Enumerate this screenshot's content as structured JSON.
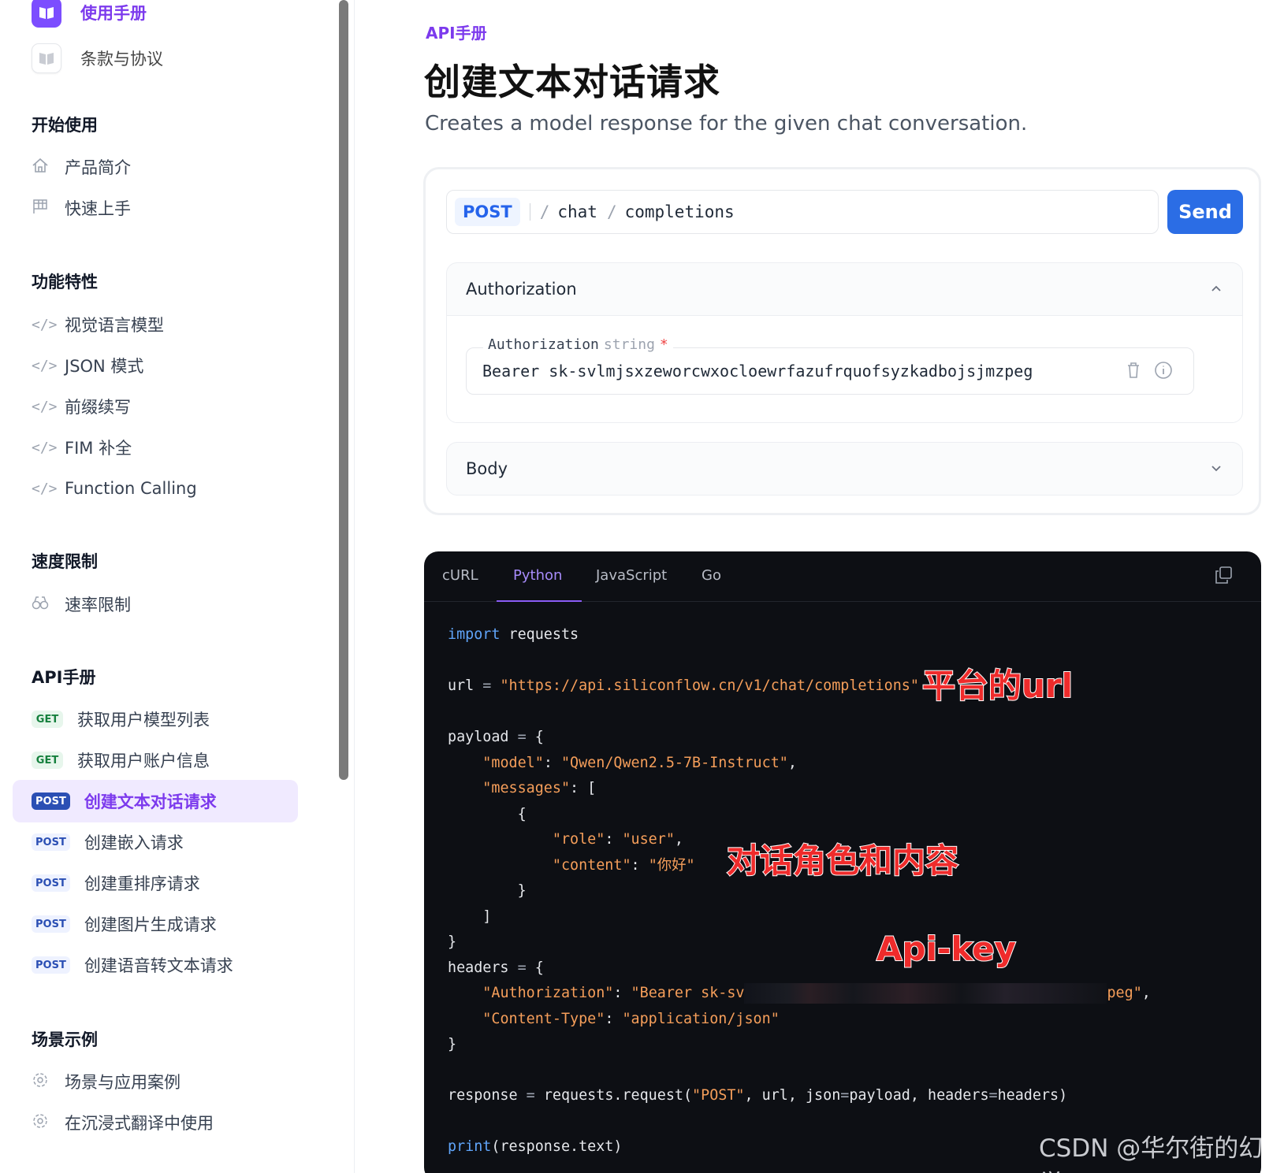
{
  "sidebar": {
    "top_links": [
      {
        "label": "使用手册",
        "active": true
      },
      {
        "label": "条款与协议",
        "active": false
      }
    ],
    "sections": [
      {
        "title": "开始使用",
        "items": [
          {
            "icon": "home-icon",
            "label": "产品简介"
          },
          {
            "icon": "flag-icon",
            "label": "快速上手"
          }
        ]
      },
      {
        "title": "功能特性",
        "items": [
          {
            "icon": "code-icon",
            "label": "视觉语言模型"
          },
          {
            "icon": "code-icon",
            "label": "JSON 模式"
          },
          {
            "icon": "code-icon",
            "label": "前缀续写"
          },
          {
            "icon": "code-icon",
            "label": "FIM 补全"
          },
          {
            "icon": "code-icon",
            "label": "Function Calling"
          }
        ]
      },
      {
        "title": "速度限制",
        "items": [
          {
            "icon": "binoculars-icon",
            "label": "速率限制"
          }
        ]
      },
      {
        "title": "API手册",
        "api_items": [
          {
            "method": "GET",
            "label": "获取用户模型列表",
            "active": false
          },
          {
            "method": "GET",
            "label": "获取用户账户信息",
            "active": false
          },
          {
            "method": "POST",
            "label": "创建文本对话请求",
            "active": true
          },
          {
            "method": "POST",
            "label": "创建嵌入请求",
            "active": false
          },
          {
            "method": "POST",
            "label": "创建重排序请求",
            "active": false
          },
          {
            "method": "POST",
            "label": "创建图片生成请求",
            "active": false
          },
          {
            "method": "POST",
            "label": "创建语音转文本请求",
            "active": false
          }
        ]
      },
      {
        "title": "场景示例",
        "items": [
          {
            "icon": "gear-icon",
            "label": "场景与应用案例"
          },
          {
            "icon": "gear-icon",
            "label": "在沉浸式翻译中使用"
          }
        ]
      }
    ]
  },
  "main": {
    "breadcrumb": "API手册",
    "title": "创建文本对话请求",
    "subtitle": "Creates a model response for the given chat conversation.",
    "request": {
      "method": "POST",
      "path": [
        "chat",
        "completions"
      ],
      "send_label": "Send",
      "auth_panel_title": "Authorization",
      "auth_field_label": "Authorization",
      "auth_field_type": "string",
      "auth_field_required": "*",
      "auth_value": "Bearer sk-svlmjsxzeworcwxocloewrfazufrquofsyzkadbojsjmzpeg",
      "body_panel_title": "Body"
    },
    "code": {
      "tabs": [
        "cURL",
        "Python",
        "JavaScript",
        "Go"
      ],
      "active_tab": "Python",
      "lines": {
        "import_kw": "import",
        "import_mod": " requests",
        "url_var": "url",
        "url_value": "\"https://api.siliconflow.cn/v1/chat/completions\"",
        "payload_var": "payload",
        "model_key": "\"model\"",
        "model_value": "\"Qwen/Qwen2.5-7B-Instruct\"",
        "messages_key": "\"messages\"",
        "role_key": "\"role\"",
        "role_value": "\"user\"",
        "content_key": "\"content\"",
        "content_value": "\"你好\"",
        "headers_var": "headers",
        "auth_key": "\"Authorization\"",
        "auth_value_start": "\"Bearer sk-sv",
        "auth_value_end": "peg\"",
        "ctype_key": "\"Content-Type\"",
        "ctype_value": "\"application/json\"",
        "response_var": "response",
        "request_call": "requests.request(",
        "post_str": "\"POST\"",
        "request_args": ", url, json",
        "request_args2": "payload, headers",
        "request_args3": "headers)",
        "print_kw": "print",
        "print_arg": "(response.text)"
      }
    },
    "annotations": {
      "url_note": "平台的url",
      "role_note": "对话角色和内容",
      "key_note": "Api-key"
    },
    "watermark": "CSDN @华尔街的幻觉"
  }
}
